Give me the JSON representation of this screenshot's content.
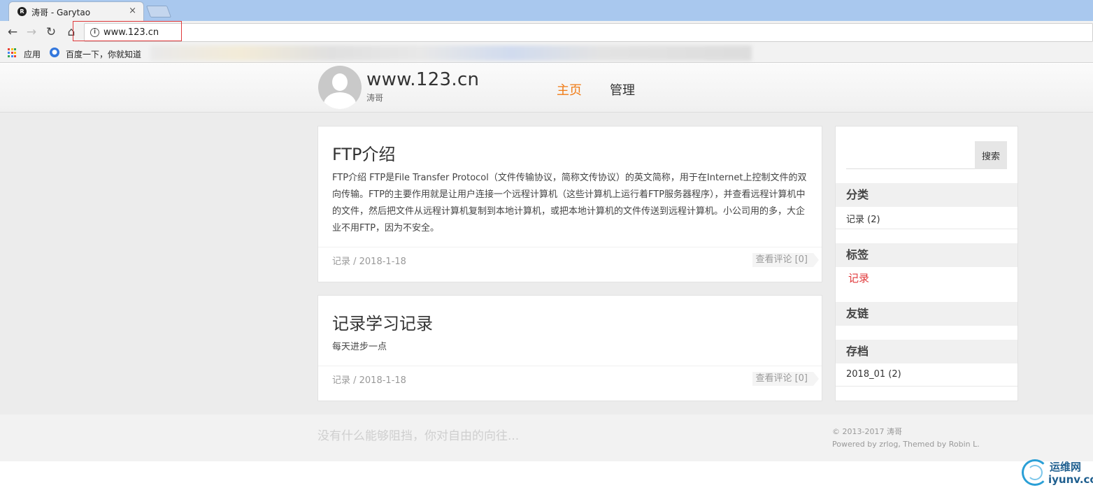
{
  "browser": {
    "tab_title": "涛哥 - Garytao",
    "tab_close": "×",
    "url": "www.123.cn",
    "bookmarks": [
      {
        "label": "应用",
        "icon": "apps-grid-icon"
      },
      {
        "label": "百度一下，你就知道",
        "icon": "baidu-paw-icon"
      }
    ]
  },
  "site": {
    "title": "www.123.cn",
    "subtitle": "涛哥",
    "nav": [
      {
        "label": "主页",
        "active": true
      },
      {
        "label": "管理",
        "active": false
      }
    ],
    "accent_color": "#f07b15"
  },
  "posts": [
    {
      "title": "FTP介绍",
      "body": "FTP介绍 FTP是File Transfer Protocol（文件传输协议，简称文传协议）的英文简称，用于在Internet上控制文件的双向传输。FTP的主要作用就是让用户连接一个远程计算机（这些计算机上运行着FTP服务器程序），并查看远程计算机中的文件，然后把文件从远程计算机复制到本地计算机，或把本地计算机的文件传送到远程计算机。小公司用的多，大企业不用FTP，因为不安全。",
      "meta": "记录 / 2018-1-18",
      "comments": "查看评论 [0]"
    },
    {
      "title": "记录学习记录",
      "body": "每天进步一点",
      "meta": "记录 / 2018-1-18",
      "comments": "查看评论 [0]"
    }
  ],
  "sidebar": {
    "search_placeholder": "",
    "search_button": "搜索",
    "categories_title": "分类",
    "categories": [
      "记录 (2)"
    ],
    "tags_title": "标签",
    "tags": [
      "记录"
    ],
    "links_title": "友链",
    "archive_title": "存档",
    "archives": [
      "2018_01 (2)"
    ]
  },
  "footer": {
    "motto": "没有什么能够阻挡，你对自由的向往...",
    "copyright": "© 2013-2017 涛哥",
    "powered": "Powered by zrlog, Themed by Robin L."
  },
  "watermark": {
    "cn": "运维网",
    "en": "iyunv.com"
  }
}
